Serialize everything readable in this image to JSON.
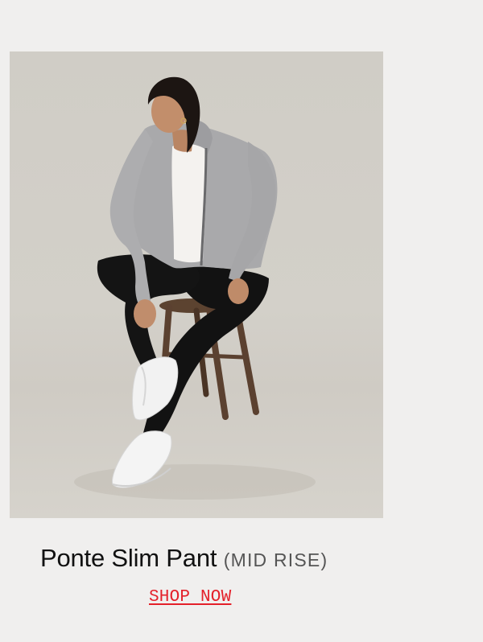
{
  "product": {
    "image_alt": "Woman wearing a grey zip hoodie, white tee, black ponte slim pants and white sneakers, seated on a wooden stool",
    "name": "Ponte Slim Pant",
    "rise": "(MID RISE)",
    "cta_label": "SHOP NOW"
  },
  "colors": {
    "page_background": "#f0efee",
    "cta": "#e4202a",
    "title": "#111111",
    "subtitle": "#555555"
  }
}
